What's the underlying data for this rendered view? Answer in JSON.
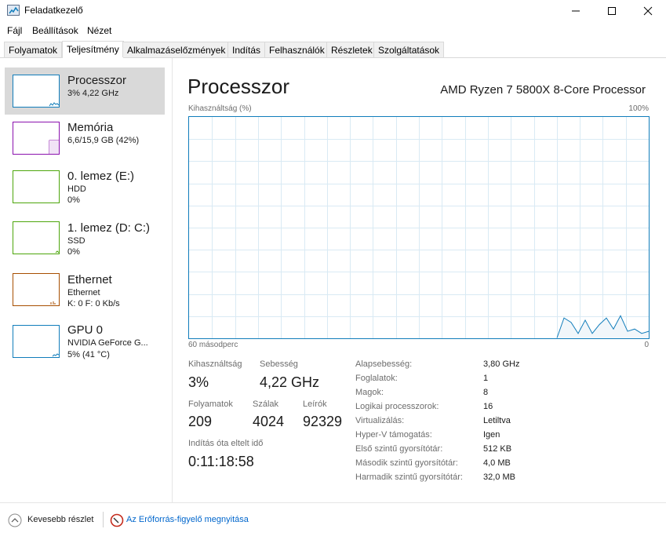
{
  "window": {
    "title": "Feladatkezelő"
  },
  "menu": [
    "Fájl",
    "Beállítások",
    "Nézet"
  ],
  "tabs": [
    "Folyamatok",
    "Teljesítmény",
    "Alkalmazáselőzmények",
    "Indítás",
    "Felhasználók",
    "Részletek",
    "Szolgáltatások"
  ],
  "sidebar": {
    "items": [
      {
        "name": "Processzor",
        "sub1": "3% 4,22 GHz",
        "sub2": "",
        "color": "#117dbb"
      },
      {
        "name": "Memória",
        "sub1": "6,6/15,9 GB (42%)",
        "sub2": "",
        "color": "#8b12ae"
      },
      {
        "name": "0. lemez (E:)",
        "sub1": "HDD",
        "sub2": "0%",
        "color": "#4da60c"
      },
      {
        "name": "1. lemez (D: C:)",
        "sub1": "SSD",
        "sub2": "0%",
        "color": "#4da60c"
      },
      {
        "name": "Ethernet",
        "sub1": "Ethernet",
        "sub2": "K: 0 F: 0 Kb/s",
        "color": "#a74f01"
      },
      {
        "name": "GPU 0",
        "sub1": "NVIDIA GeForce G...",
        "sub2": "5% (41 °C)",
        "color": "#117dbb"
      }
    ]
  },
  "main": {
    "title": "Processzor",
    "cpu_model": "AMD Ryzen 7 5800X 8-Core Processor",
    "graph_title": "Kihasználtság (%)",
    "graph_max": "100%",
    "graph_time": "60 másodperc",
    "graph_min": "0",
    "accent": "#117dbb"
  },
  "stats": {
    "util_label": "Kihasználtság",
    "util_value": "3%",
    "speed_label": "Sebesség",
    "speed_value": "4,22 GHz",
    "proc_label": "Folyamatok",
    "proc_value": "209",
    "threads_label": "Szálak",
    "threads_value": "4024",
    "handles_label": "Leírók",
    "handles_value": "92329",
    "uptime_label": "Indítás óta eltelt idő",
    "uptime_value": "0:11:18:58"
  },
  "details": [
    {
      "label": "Alapsebesség:",
      "value": "3,80 GHz"
    },
    {
      "label": "Foglalatok:",
      "value": "1"
    },
    {
      "label": "Magok:",
      "value": "8"
    },
    {
      "label": "Logikai processzorok:",
      "value": "16"
    },
    {
      "label": "Virtualizálás:",
      "value": "Letiltva"
    },
    {
      "label": "Hyper-V támogatás:",
      "value": "Igen"
    },
    {
      "label": "Első szintű gyorsítótár:",
      "value": "512 KB"
    },
    {
      "label": "Második szintű gyorsítótár:",
      "value": "4,0 MB"
    },
    {
      "label": "Harmadik szintű gyorsítótár:",
      "value": "32,0 MB"
    }
  ],
  "footer": {
    "less_details": "Kevesebb részlet",
    "resmon": "Az Erőforrás-figyelő megnyitása"
  },
  "chart_data": {
    "type": "line",
    "title": "Kihasználtság (%)",
    "xlabel": "60 másodperc",
    "ylim": [
      0,
      100
    ],
    "x": [
      60,
      57,
      54,
      51,
      48,
      45,
      42,
      39,
      36,
      33,
      30,
      27,
      24,
      21,
      18,
      15,
      12,
      9,
      6,
      3,
      0
    ],
    "series": [
      {
        "values": [
          0,
          0,
          0,
          0,
          0,
          0,
          0,
          0,
          0,
          0,
          0,
          0,
          0,
          0,
          0,
          0,
          0,
          0,
          0,
          0,
          0
        ]
      }
    ],
    "recent_tail": [
      0,
      9,
      7,
      2,
      8,
      2,
      6,
      9,
      4,
      10,
      3,
      4,
      2,
      3
    ]
  }
}
